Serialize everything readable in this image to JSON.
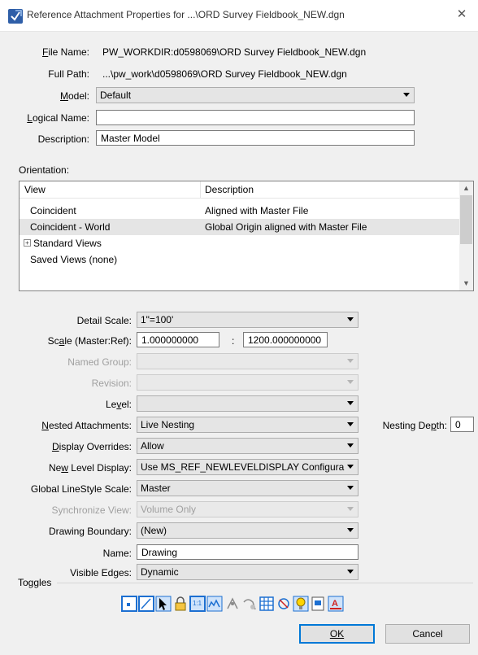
{
  "window": {
    "title": "Reference Attachment Properties for ...\\ORD Survey Fieldbook_NEW.dgn",
    "close_glyph": "✕"
  },
  "file": {
    "file_name_label": "File Name:",
    "file_name_value": "PW_WORKDIR:d0598069\\ORD Survey Fieldbook_NEW.dgn",
    "full_path_label": "Full Path:",
    "full_path_value": "...\\pw_work\\d0598069\\ORD Survey Fieldbook_NEW.dgn",
    "model_label": "Model:",
    "model_value": "Default",
    "logical_name_label": "Logical Name:",
    "logical_name_value": "",
    "description_label": "Description:",
    "description_value": "Master Model"
  },
  "orientation": {
    "label": "Orientation:",
    "columns": [
      "View",
      "Description"
    ],
    "rows": [
      {
        "view": "Coincident",
        "description": "Aligned with Master File",
        "selected": false
      },
      {
        "view": "Coincident - World",
        "description": "Global Origin aligned with Master File",
        "selected": true
      },
      {
        "view": "Standard Views",
        "description": "",
        "selected": false,
        "expandable": true
      },
      {
        "view": "Saved Views (none)",
        "description": "",
        "selected": false
      }
    ]
  },
  "settings": {
    "detail_scale_label": "Detail Scale:",
    "detail_scale_value": "1\"=100'",
    "scale_label": "Scale (Master:Ref):",
    "scale_master": "1.000000000",
    "scale_colon": ":",
    "scale_ref": "1200.000000000",
    "named_group_label": "Named Group:",
    "named_group_value": "",
    "revision_label": "Revision:",
    "revision_value": "",
    "level_label": "Level:",
    "level_value": "",
    "nested_label": "Nested Attachments:",
    "nested_value": "Live Nesting",
    "nesting_depth_label": "Nesting Depth:",
    "nesting_depth_value": "0",
    "display_overrides_label": "Display Overrides:",
    "display_overrides_value": "Allow",
    "new_level_display_label": "New Level Display:",
    "new_level_display_value": "Use MS_REF_NEWLEVELDISPLAY Configura",
    "global_linestyle_label": "Global LineStyle Scale:",
    "global_linestyle_value": "Master",
    "sync_view_label": "Synchronize View:",
    "sync_view_value": "Volume Only",
    "drawing_boundary_label": "Drawing Boundary:",
    "drawing_boundary_value": "(New)",
    "name_label": "Name:",
    "name_value": "Drawing",
    "visible_edges_label": "Visible Edges:",
    "visible_edges_value": "Dynamic"
  },
  "toggles": {
    "label": "Toggles",
    "icons": [
      "display-toggle-icon",
      "snap-toggle-icon",
      "locate-toggle-icon",
      "lock-toggle-icon",
      "scale-line-styles-icon",
      "treat-as-element-icon",
      "ignore-attach-icon",
      "use-lights-icon",
      "raster-toggle-icon",
      "print-toggle-icon",
      "lightbulb-icon",
      "annotation-scale-icon",
      "text-style-icon"
    ]
  },
  "buttons": {
    "ok": "OK",
    "cancel": "Cancel"
  },
  "colors": {
    "accent": "#0078d7",
    "selected_row": "#e5e5e5"
  }
}
